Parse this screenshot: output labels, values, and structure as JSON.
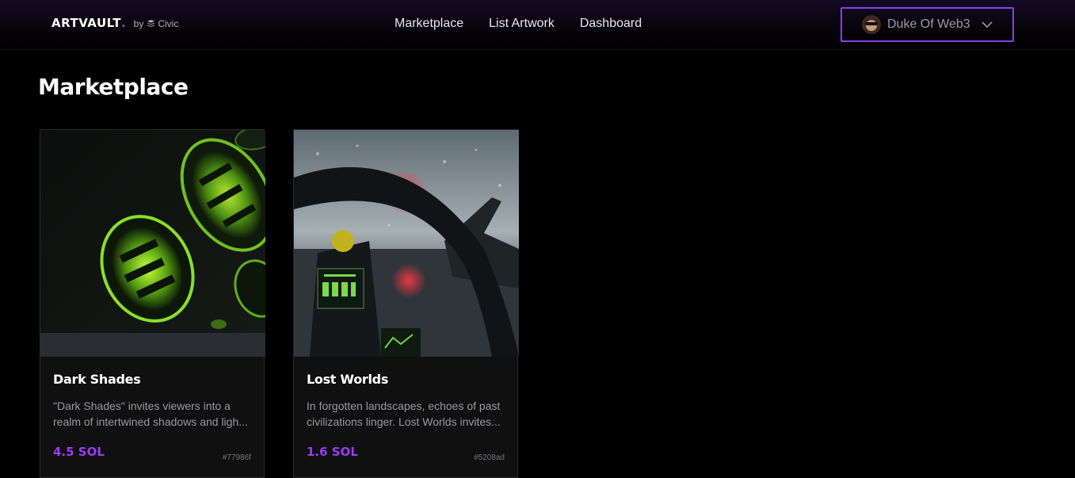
{
  "header": {
    "logo_text": "ARTVAULT",
    "logo_dot": ".",
    "by_label": "by",
    "partner_label": "Civic",
    "nav": [
      {
        "label": "Marketplace"
      },
      {
        "label": "List Artwork"
      },
      {
        "label": "Dashboard"
      }
    ],
    "user": {
      "name": "Duke Of Web3",
      "avatar_icon": "user-avatar",
      "menu_icon": "chevron-down-icon"
    }
  },
  "page": {
    "title": "Marketplace"
  },
  "colors": {
    "accent": "#9b3cf5",
    "background": "#000000",
    "card_bg": "#101010"
  },
  "cards": [
    {
      "title": "Dark Shades",
      "desc_line1": "\"Dark Shades\" invites viewers into a",
      "desc_line2": "realm of intertwined shadows and ligh...",
      "price": "4.5 SOL",
      "token_id": "#77986f",
      "image_icon": "green-coins-artwork"
    },
    {
      "title": "Lost Worlds",
      "desc_line1": "In forgotten landscapes, echoes of past",
      "desc_line2": "civilizations linger. Lost Worlds invites...",
      "price": "1.6 SOL",
      "token_id": "#5208ad",
      "image_icon": "jet-cockpit-artwork"
    }
  ]
}
